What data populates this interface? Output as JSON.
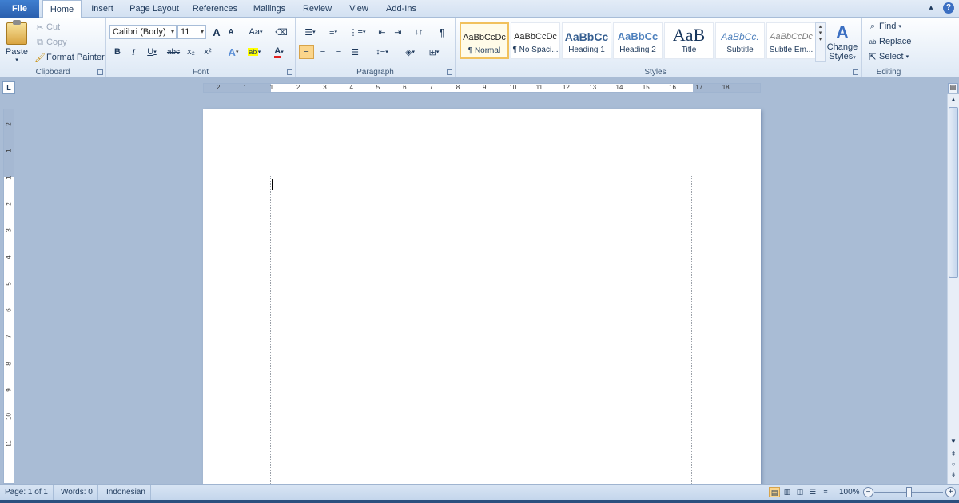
{
  "tabs": {
    "file": "File",
    "home": "Home",
    "insert": "Insert",
    "page_layout": "Page Layout",
    "references": "References",
    "mailings": "Mailings",
    "review": "Review",
    "view": "View",
    "addins": "Add-Ins"
  },
  "titlebar": {
    "minimize_ribbon_icon": "chevron-up-icon",
    "help_icon": "help-icon",
    "help_glyph": "?"
  },
  "clipboard": {
    "label": "Clipboard",
    "paste": "Paste",
    "cut": "Cut",
    "copy": "Copy",
    "format_painter": "Format Painter"
  },
  "font": {
    "label": "Font",
    "name": "Calibri (Body)",
    "size": "11",
    "grow": "A",
    "shrink": "A",
    "change_case": "Aa",
    "bold": "B",
    "italic": "I",
    "underline": "U",
    "strike": "abc",
    "subscript": "x₂",
    "superscript": "x²",
    "font_color": "A"
  },
  "paragraph": {
    "label": "Paragraph",
    "show_marks": "¶"
  },
  "styles": {
    "label": "Styles",
    "items": [
      {
        "preview": "AaBbCcDc",
        "name": "¶ Normal"
      },
      {
        "preview": "AaBbCcDc",
        "name": "¶ No Spaci..."
      },
      {
        "preview": "AaBbCc",
        "name": "Heading 1"
      },
      {
        "preview": "AaBbCc",
        "name": "Heading 2"
      },
      {
        "preview": "AaB",
        "name": "Title"
      },
      {
        "preview": "AaBbCc.",
        "name": "Subtitle"
      },
      {
        "preview": "AaBbCcDc",
        "name": "Subtle Em..."
      }
    ],
    "change_styles_line1": "Change",
    "change_styles_line2": "Styles"
  },
  "editing": {
    "label": "Editing",
    "find": "Find",
    "replace": "Replace",
    "select": "Select"
  },
  "ruler": {
    "corner": "L",
    "marks": [
      "2",
      "1",
      "1",
      "2",
      "3",
      "4",
      "5",
      "6",
      "7",
      "8",
      "9",
      "10",
      "11",
      "12",
      "13",
      "14",
      "15",
      "16",
      "17",
      "18"
    ],
    "vmarks": [
      "2",
      "1",
      "1",
      "2",
      "3",
      "4",
      "5",
      "6",
      "7",
      "8",
      "9",
      "10",
      "11"
    ]
  },
  "status": {
    "page": "Page: 1 of 1",
    "words": "Words: 0",
    "language": "Indonesian",
    "zoom": "100%",
    "zoom_level": 1.0
  },
  "colors": {
    "accent": "#2a5fae",
    "highlight": "#fbd58b",
    "page_bg": "#a9bcd5"
  }
}
